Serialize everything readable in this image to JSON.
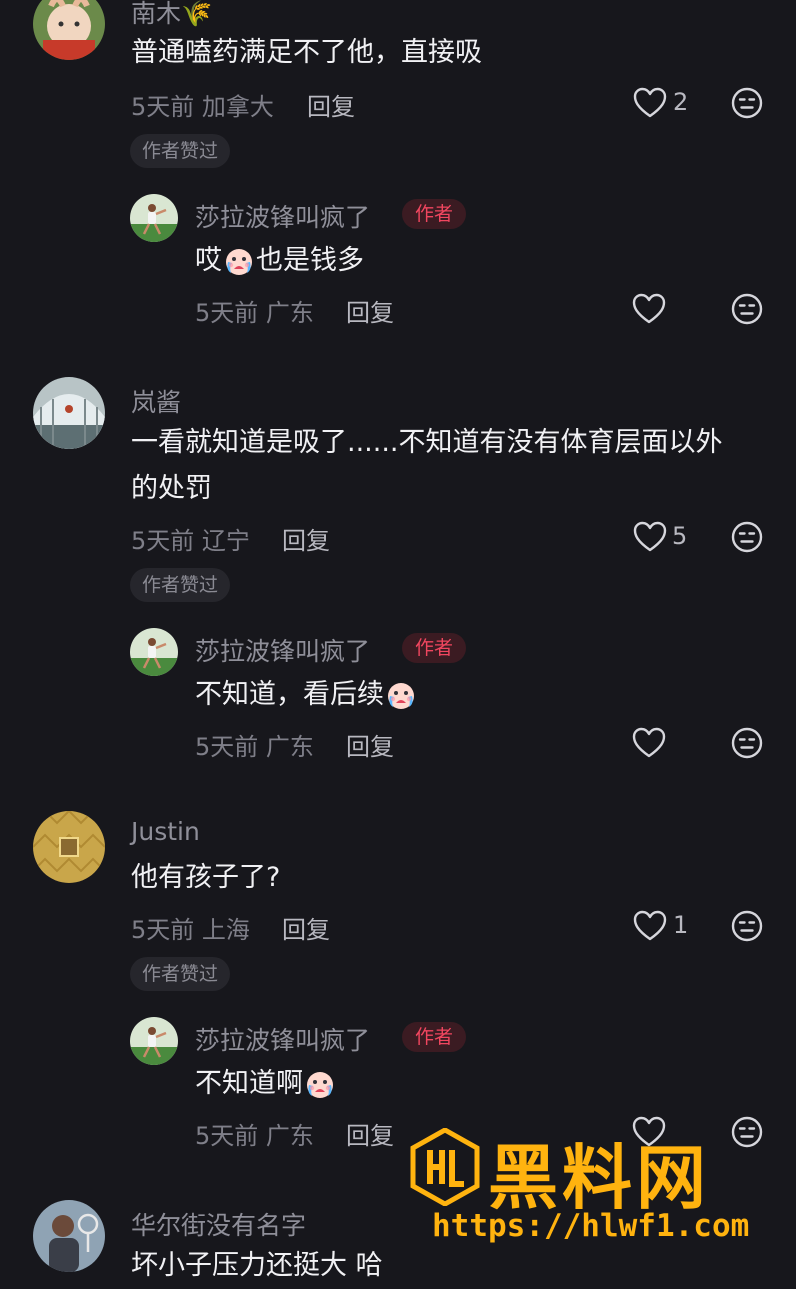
{
  "comments": [
    {
      "user": "南木🌾",
      "text": "普通嗑药满足不了他，直接吸",
      "time_location": "5天前 加拿大",
      "reply_label": "回复",
      "likes": "2",
      "liked_by_author": "作者赞过",
      "reply": {
        "user": "莎拉波锋叫疯了",
        "author_badge": "作者",
        "text_before": "哎",
        "text_after": "也是钱多",
        "time_location": "5天前 广东",
        "reply_label": "回复"
      }
    },
    {
      "user": "岚酱",
      "text_line1": "一看就知道是吸了......不知道有没有体育层面以外",
      "text_line2": "的处罚",
      "time_location": "5天前 辽宁",
      "reply_label": "回复",
      "likes": "5",
      "liked_by_author": "作者赞过",
      "reply": {
        "user": "莎拉波锋叫疯了",
        "author_badge": "作者",
        "text": "不知道，看后续",
        "time_location": "5天前 广东",
        "reply_label": "回复"
      }
    },
    {
      "user": "Justin",
      "text": "他有孩子了?",
      "time_location": "5天前 上海",
      "reply_label": "回复",
      "likes": "1",
      "liked_by_author": "作者赞过",
      "reply": {
        "user": "莎拉波锋叫疯了",
        "author_badge": "作者",
        "text": "不知道啊",
        "time_location": "5天前 广东",
        "reply_label": "回复"
      }
    },
    {
      "user": "华尔街没有名字",
      "text": "坏小子压力还挺大 哈"
    }
  ],
  "watermark": {
    "title": "黑料网",
    "url": "https://hlwf1.com"
  },
  "icons": {
    "like": "heart-outline-icon",
    "dislike": "unamused-face-icon",
    "emoji": "crying-face-emoji"
  },
  "colors": {
    "background": "#17171c",
    "author_badge": "#f0465f",
    "watermark": "#ffb30f"
  }
}
